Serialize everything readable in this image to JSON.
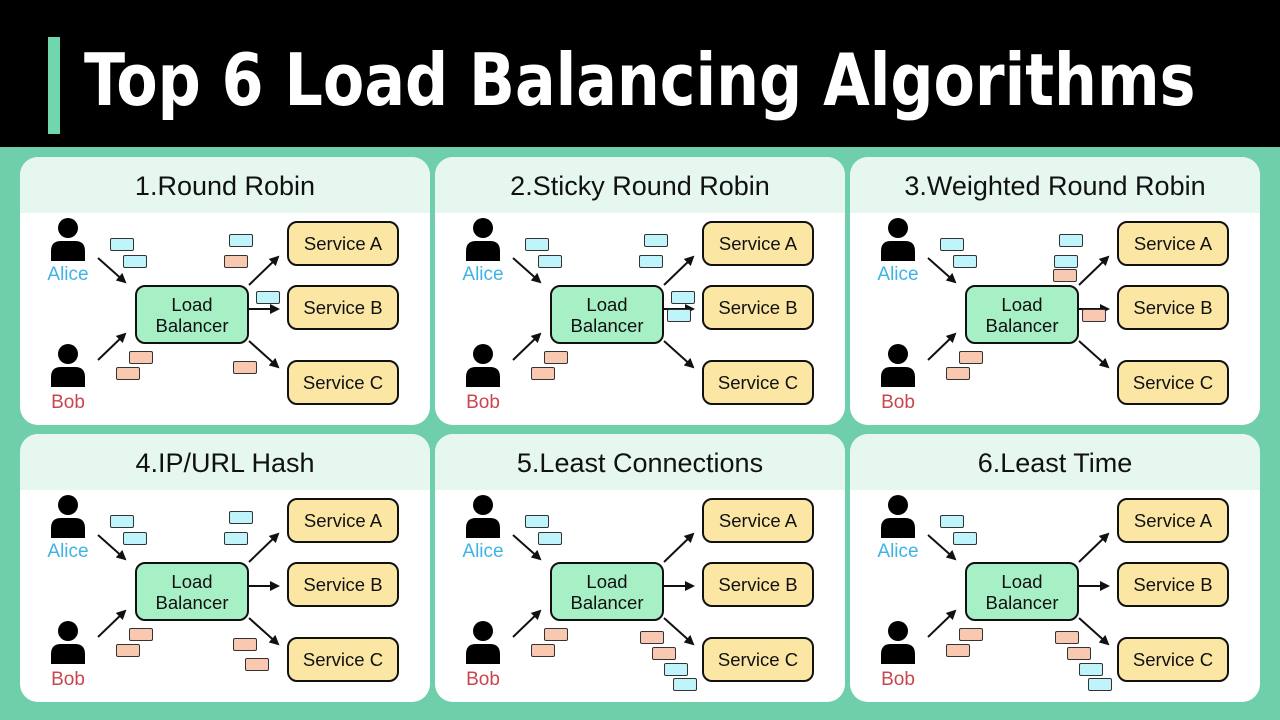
{
  "title": "Top 6 Load Balancing Algorithms",
  "colors": {
    "background": "#6fcfab",
    "accent": "#6fd6ae",
    "header_band": "#e6f7f0",
    "load_balancer": "#a7f0c6",
    "service": "#fbe7a3",
    "alice_packet": "#bff4fb",
    "bob_packet": "#f9c8b0",
    "alice_label": "#3fb2e6",
    "bob_label": "#c8474f"
  },
  "common": {
    "client_1": "Alice",
    "client_2": "Bob",
    "load_balancer_line1": "Load",
    "load_balancer_line2": "Balancer",
    "services": [
      "Service A",
      "Service B",
      "Service C"
    ]
  },
  "panels": [
    {
      "title": "1.Round Robin",
      "packets": [
        {
          "owner": "alice",
          "zone": "in-alice",
          "slot": 0
        },
        {
          "owner": "alice",
          "zone": "in-alice",
          "slot": 1
        },
        {
          "owner": "bob",
          "zone": "in-bob",
          "slot": 0
        },
        {
          "owner": "bob",
          "zone": "in-bob",
          "slot": 1
        },
        {
          "owner": "alice",
          "zone": "to-a",
          "slot": 0
        },
        {
          "owner": "bob",
          "zone": "to-a",
          "slot": 1
        },
        {
          "owner": "alice",
          "zone": "to-b",
          "slot": 0
        },
        {
          "owner": "bob",
          "zone": "to-c",
          "slot": 0
        }
      ]
    },
    {
      "title": "2.Sticky Round Robin",
      "packets": [
        {
          "owner": "alice",
          "zone": "in-alice",
          "slot": 0
        },
        {
          "owner": "alice",
          "zone": "in-alice",
          "slot": 1
        },
        {
          "owner": "bob",
          "zone": "in-bob",
          "slot": 0
        },
        {
          "owner": "bob",
          "zone": "in-bob",
          "slot": 1
        },
        {
          "owner": "alice",
          "zone": "to-a",
          "slot": 0
        },
        {
          "owner": "alice",
          "zone": "to-a",
          "slot": 1
        },
        {
          "owner": "alice",
          "zone": "to-b",
          "slot": 0
        },
        {
          "owner": "alice",
          "zone": "to-b",
          "slot": 1
        }
      ]
    },
    {
      "title": "3.Weighted Round Robin",
      "packets": [
        {
          "owner": "alice",
          "zone": "in-alice",
          "slot": 0
        },
        {
          "owner": "alice",
          "zone": "in-alice",
          "slot": 1
        },
        {
          "owner": "bob",
          "zone": "in-bob",
          "slot": 0
        },
        {
          "owner": "bob",
          "zone": "in-bob",
          "slot": 1
        },
        {
          "owner": "alice",
          "zone": "to-a",
          "slot": 0
        },
        {
          "owner": "alice",
          "zone": "to-a",
          "slot": 1
        },
        {
          "owner": "bob",
          "zone": "to-a",
          "slot": 2
        },
        {
          "owner": "bob",
          "zone": "to-b",
          "slot": 1
        }
      ]
    },
    {
      "title": "4.IP/URL Hash",
      "packets": [
        {
          "owner": "alice",
          "zone": "in-alice",
          "slot": 0
        },
        {
          "owner": "alice",
          "zone": "in-alice",
          "slot": 1
        },
        {
          "owner": "bob",
          "zone": "in-bob",
          "slot": 0
        },
        {
          "owner": "bob",
          "zone": "in-bob",
          "slot": 1
        },
        {
          "owner": "alice",
          "zone": "to-a",
          "slot": 0
        },
        {
          "owner": "alice",
          "zone": "to-a",
          "slot": 1
        },
        {
          "owner": "bob",
          "zone": "to-c",
          "slot": 0
        },
        {
          "owner": "bob",
          "zone": "to-c",
          "slot": 1
        }
      ]
    },
    {
      "title": "5.Least Connections",
      "packets": [
        {
          "owner": "alice",
          "zone": "in-alice",
          "slot": 0
        },
        {
          "owner": "alice",
          "zone": "in-alice",
          "slot": 1
        },
        {
          "owner": "bob",
          "zone": "in-bob",
          "slot": 0
        },
        {
          "owner": "bob",
          "zone": "in-bob",
          "slot": 1
        },
        {
          "owner": "bob",
          "zone": "stack-c",
          "slot": 0
        },
        {
          "owner": "bob",
          "zone": "stack-c",
          "slot": 1
        },
        {
          "owner": "alice",
          "zone": "stack-c",
          "slot": 2
        },
        {
          "owner": "alice",
          "zone": "stack-c",
          "slot": 3
        }
      ]
    },
    {
      "title": "6.Least Time",
      "packets": [
        {
          "owner": "alice",
          "zone": "in-alice",
          "slot": 0
        },
        {
          "owner": "alice",
          "zone": "in-alice",
          "slot": 1
        },
        {
          "owner": "bob",
          "zone": "in-bob",
          "slot": 0
        },
        {
          "owner": "bob",
          "zone": "in-bob",
          "slot": 1
        },
        {
          "owner": "bob",
          "zone": "stack-c",
          "slot": 0
        },
        {
          "owner": "bob",
          "zone": "stack-c",
          "slot": 1
        },
        {
          "owner": "alice",
          "zone": "stack-c",
          "slot": 2
        },
        {
          "owner": "alice",
          "zone": "stack-c",
          "slot": 3
        }
      ]
    }
  ]
}
